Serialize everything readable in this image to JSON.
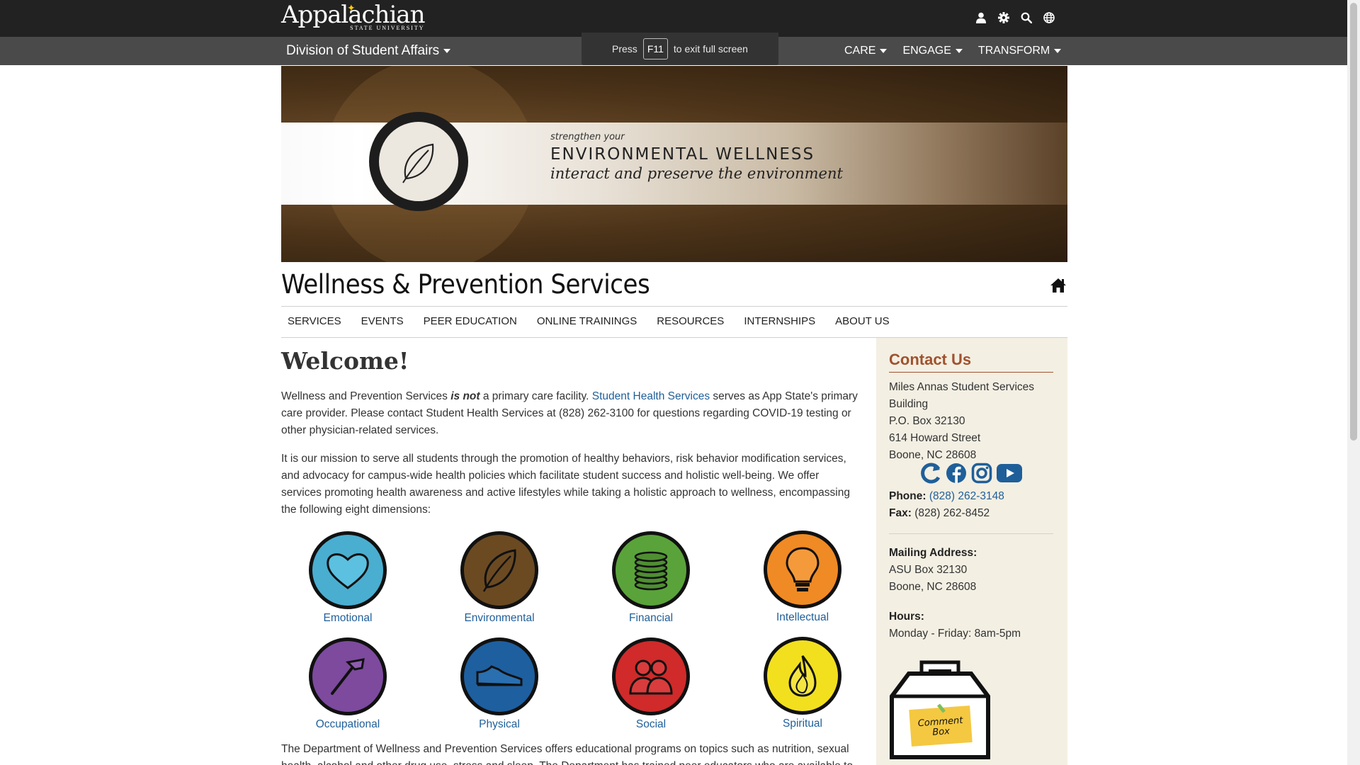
{
  "header": {
    "logo_main": "Appalachian",
    "logo_sub": "STATE UNIVERSITY",
    "icons": [
      "user-icon",
      "gear-icon",
      "search-icon",
      "globe-icon"
    ]
  },
  "subbar": {
    "division": "Division of Student Affairs",
    "nav": [
      "CARE",
      "ENGAGE",
      "TRANSFORM"
    ]
  },
  "fullscreen_notice": {
    "before": "Press",
    "key": "F11",
    "after": "to exit full screen"
  },
  "banner": {
    "pre": "strengthen your",
    "title": "ENVIRONMENTAL WELLNESS",
    "subtitle": "interact and preserve the environment"
  },
  "site": {
    "title": "Wellness & Prevention Services"
  },
  "mainnav": [
    "SERVICES",
    "EVENTS",
    "PEER EDUCATION",
    "ONLINE TRAININGS",
    "RESOURCES",
    "INTERNSHIPS",
    "ABOUT US"
  ],
  "content": {
    "heading": "Welcome!",
    "p1_a": "Wellness and Prevention Services ",
    "p1_em": "is not",
    "p1_b": " a primary care facility. ",
    "p1_link": "Student Health Services",
    "p1_c": " serves as App State's primary care provider. Please contact Student Health Services at (828) 262-3100 for questions regarding COVID-19 testing or other physician-related services.",
    "p2": "It is our mission to serve all students through the promotion of healthy behaviors, risk behavior modification services, and advocacy for campus-wide health policies which facilitate student success and holistic well-being. We offer services promoting health awareness and active lifestyles while taking a holistic approach to wellness, encompassing the following eight dimensions:",
    "p3": "The Department of Wellness and Prevention Services offers educational programs on topics such as nutrition, sexual health, alcohol and other drug use, stress and sleep. The Department has trained peer educators who are available to present"
  },
  "dimensions": [
    {
      "label": "Emotional",
      "color": "#4aaed0",
      "icon": "heart-icon"
    },
    {
      "label": "Environmental",
      "color": "#6b4a22",
      "icon": "leaf-icon"
    },
    {
      "label": "Financial",
      "color": "#5aa33a",
      "icon": "coins-icon"
    },
    {
      "label": "Intellectual",
      "color": "#f08a24",
      "icon": "lightbulb-icon"
    },
    {
      "label": "Occupational",
      "color": "#7d4a9e",
      "icon": "hammer-icon"
    },
    {
      "label": "Physical",
      "color": "#1e5fa0",
      "icon": "shoe-icon"
    },
    {
      "label": "Social",
      "color": "#d02a2a",
      "icon": "people-icon"
    },
    {
      "label": "Spiritual",
      "color": "#f2e01e",
      "icon": "flame-icon"
    }
  ],
  "sidebar": {
    "heading": "Contact Us",
    "address1": "Miles Annas Student Services",
    "address2": "Building",
    "address3": "P.O. Box 32130",
    "address4": "614 Howard Street",
    "address5": "Boone, NC 28608",
    "social": [
      "appstate-icon",
      "facebook-icon",
      "instagram-icon",
      "youtube-icon"
    ],
    "phone_label": "Phone:",
    "phone": "(828) 262-3148",
    "fax_label": "Fax:",
    "fax": "(828) 262-8452",
    "mailing_label": "Mailing Address:",
    "mailing1": "ASU Box 32130",
    "mailing2": "Boone, NC 28608",
    "hours_label": "Hours:",
    "hours": "Monday - Friday: 8am-5pm",
    "comment_box": "Comment Box"
  },
  "colors": {
    "topbar": "#222222",
    "subbar": "#4a4a4a",
    "link": "#1f5f99",
    "accent": "#a0522d",
    "sidebar_bg": "#f3efe3"
  }
}
